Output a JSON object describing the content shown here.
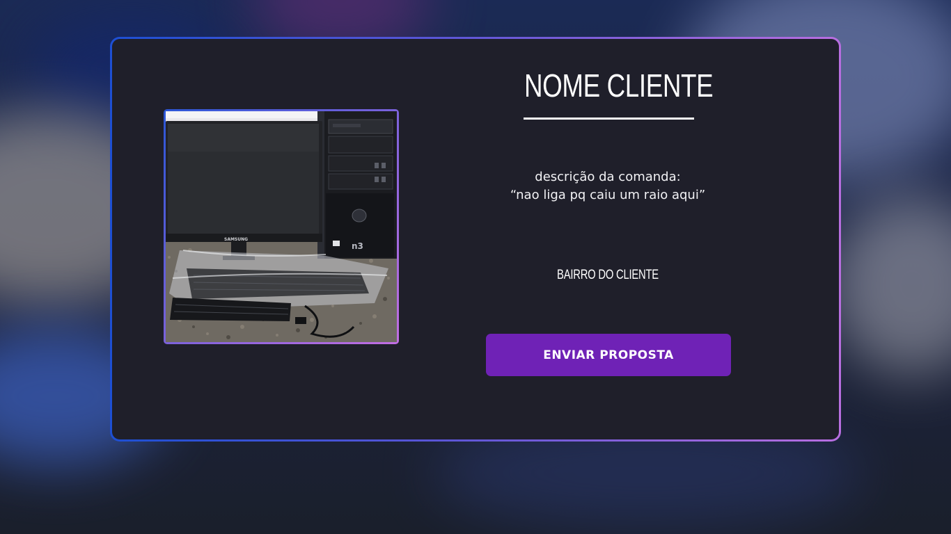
{
  "card": {
    "client_name": "NOME CLIENTE",
    "description_label": "descrição da comanda:",
    "description_text": "“nao liga pq caiu um raio aqui”",
    "neighborhood": "BAIRRO DO CLIENTE",
    "submit_label": "ENVIAR PROPOSTA"
  },
  "photo": {
    "monitor_brand": "SAMSUNG",
    "case_brand": "n3"
  },
  "colors": {
    "card_background": "#1f1f2a",
    "accent_button": "#6f22b6",
    "border_gradient_start": "#1d4fd3",
    "border_gradient_end": "#b86ee0"
  }
}
